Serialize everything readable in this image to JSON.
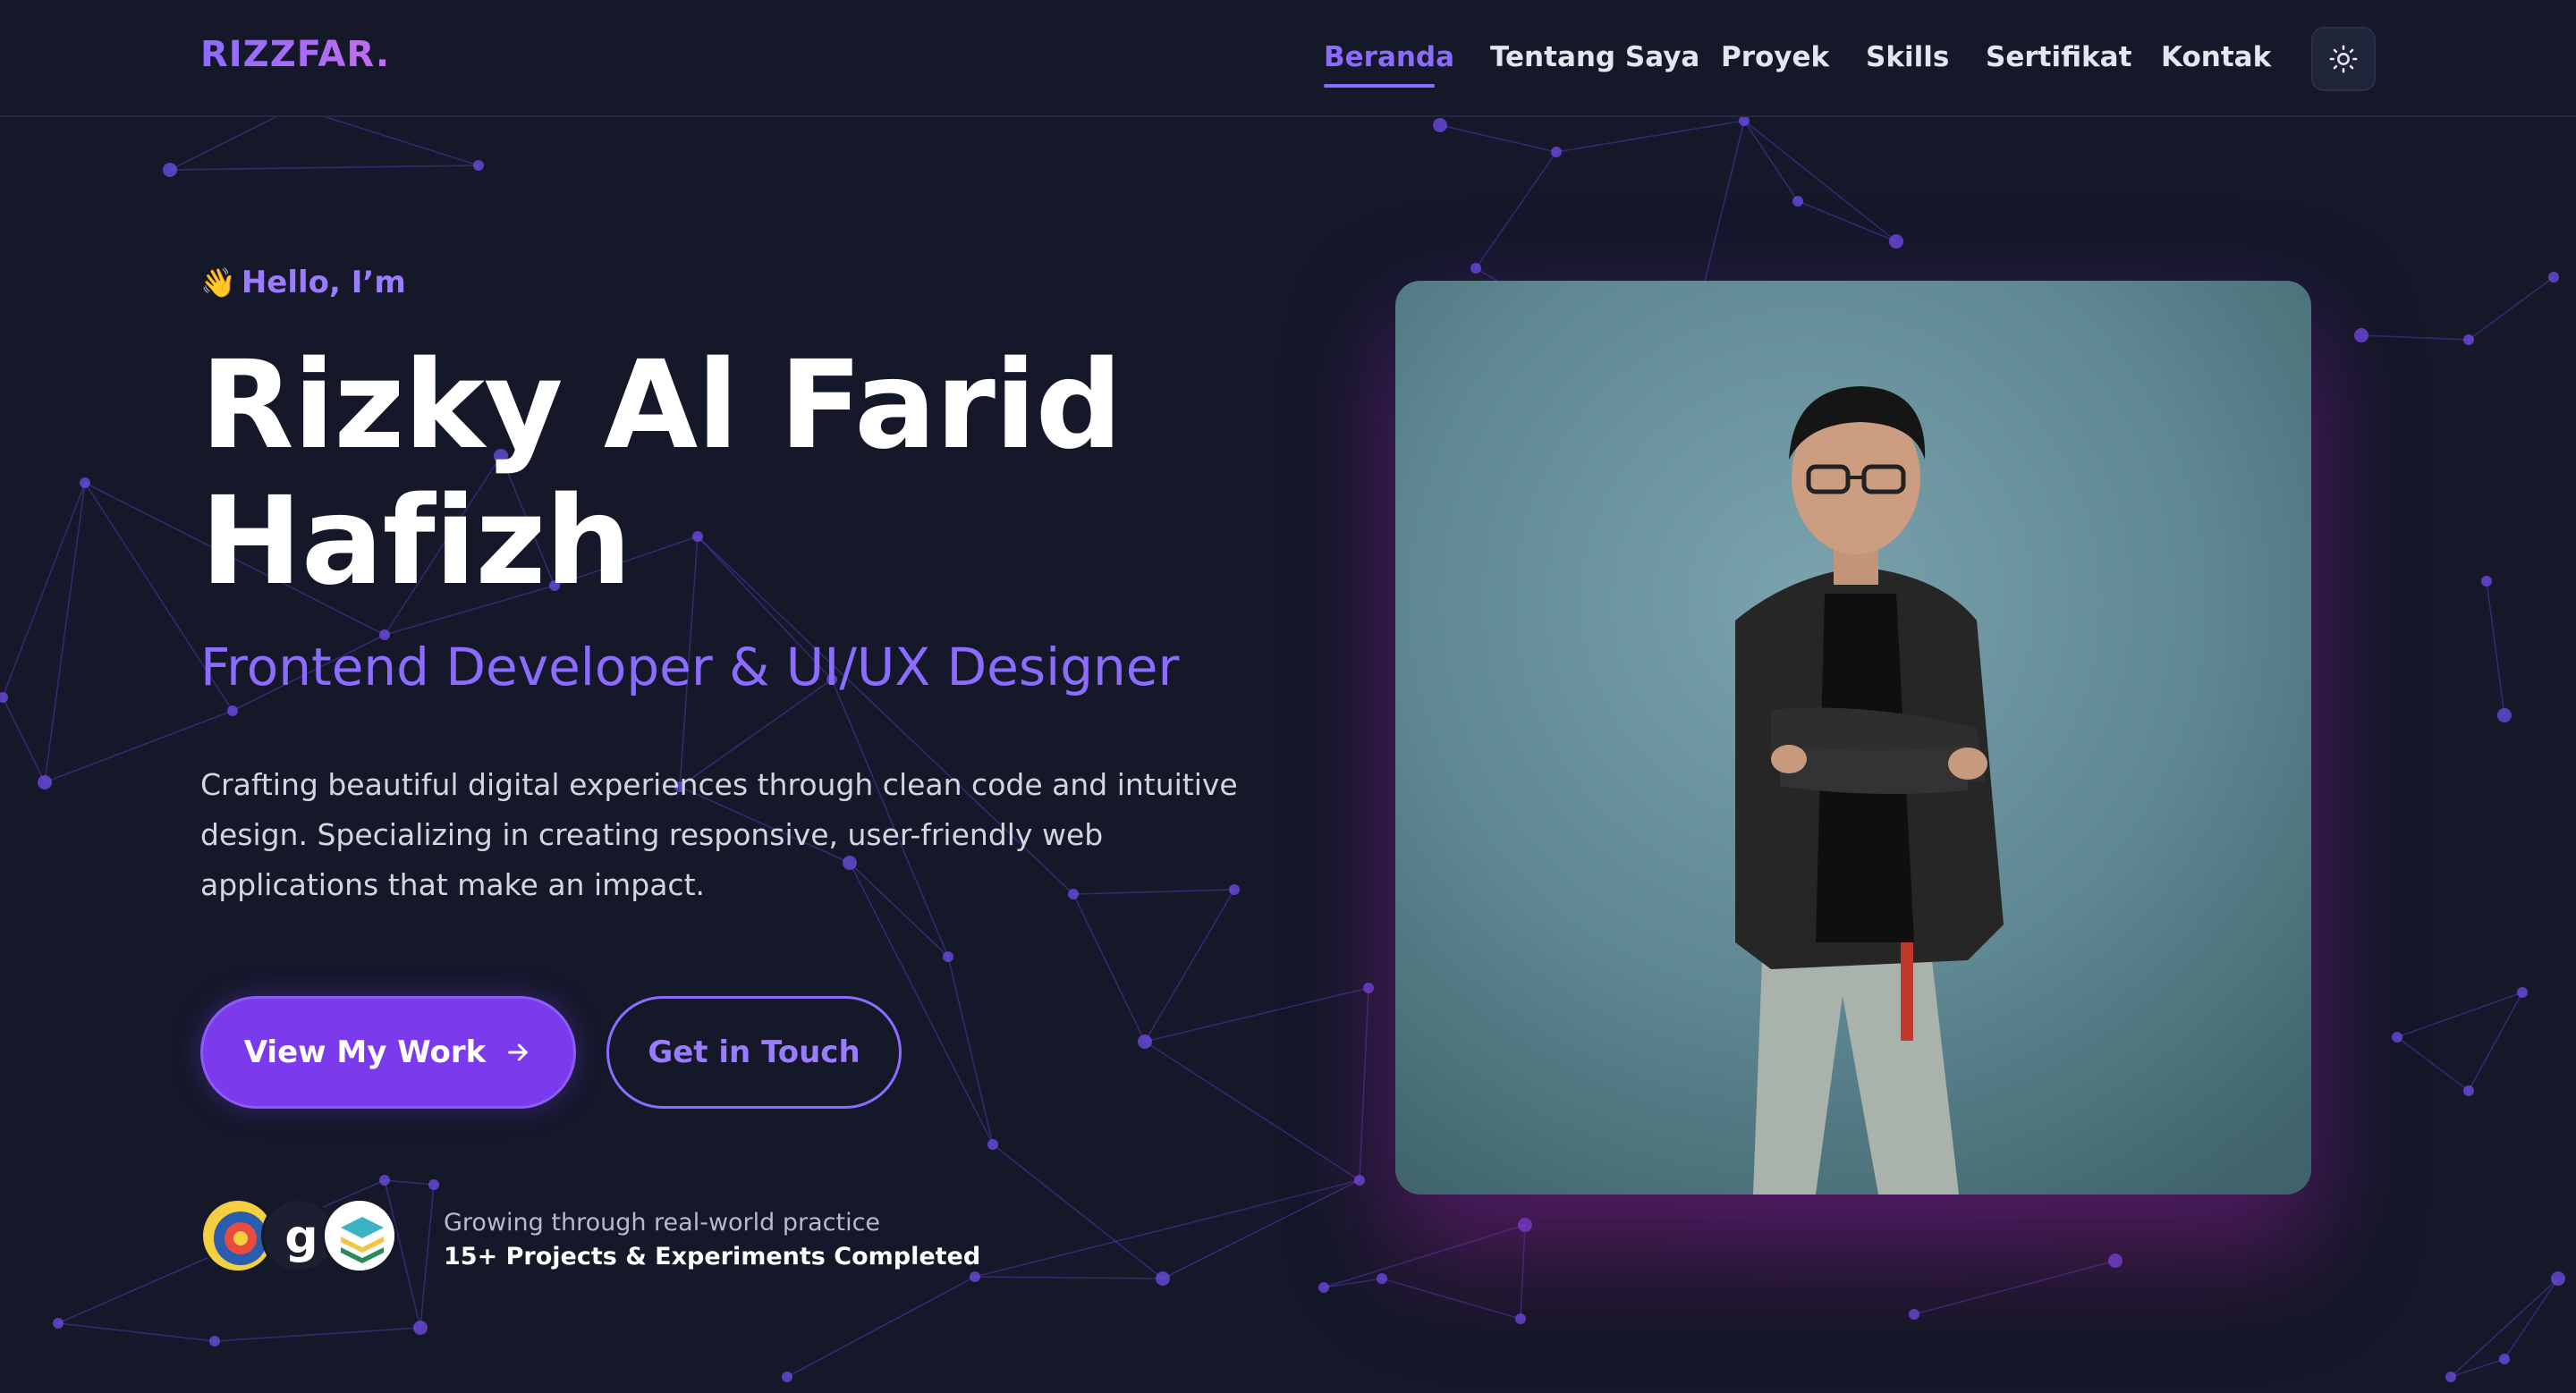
{
  "brand": {
    "logo": "RIZZFAR."
  },
  "nav": {
    "items": [
      {
        "label": "Beranda",
        "active": true
      },
      {
        "label": "Tentang Saya",
        "active": false
      },
      {
        "label": "Proyek",
        "active": false
      },
      {
        "label": "Skills",
        "active": false
      },
      {
        "label": "Sertifikat",
        "active": false
      },
      {
        "label": "Kontak",
        "active": false
      }
    ],
    "theme_toggle_icon": "sun-icon"
  },
  "hero": {
    "greeting": "Hello, I’m",
    "greeting_icon": "waving-hand-icon",
    "name_line1": "Rizky Al Farid",
    "name_line2": "Hafizh",
    "role": "Frontend Developer & UI/UX Designer",
    "description": "Crafting beautiful digital experiences through clean code and intuitive design. Specializing in creating responsive, user-friendly web applications that make an impact.",
    "primary_button": "View My Work",
    "primary_button_icon": "arrow-right-icon",
    "secondary_button": "Get in Touch",
    "social_proof_line1": "Growing through real-world practice",
    "social_proof_line2": "15+ Projects & Experiments Completed",
    "badges": [
      "institution-seal-icon",
      "g-logo-icon",
      "stack-layers-icon"
    ]
  },
  "colors": {
    "background": "#141829",
    "accent": "#8b6cff",
    "primary_button": "#7c3aed",
    "photo_backdrop": "#5f8a95"
  }
}
